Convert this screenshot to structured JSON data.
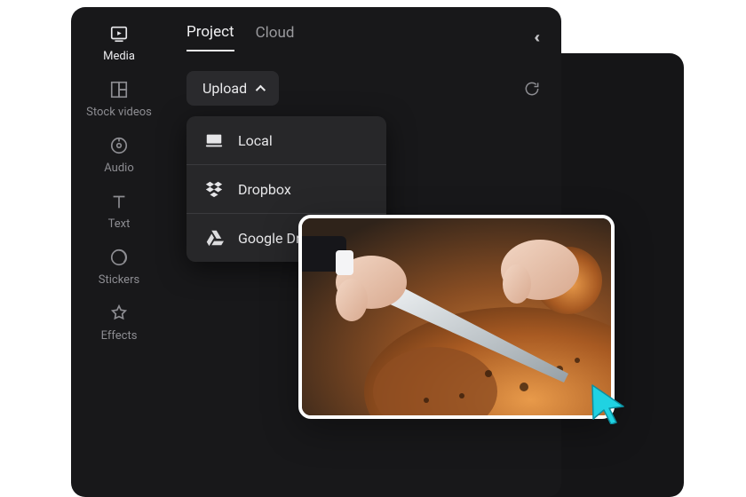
{
  "sidebar": {
    "items": [
      {
        "label": "Media"
      },
      {
        "label": "Stock videos"
      },
      {
        "label": "Audio"
      },
      {
        "label": "Text"
      },
      {
        "label": "Stickers"
      },
      {
        "label": "Effects"
      }
    ]
  },
  "tabs": {
    "project": "Project",
    "cloud": "Cloud"
  },
  "toolbar": {
    "upload_label": "Upload"
  },
  "upload_menu": {
    "items": [
      {
        "label": "Local",
        "icon": "desktop-icon"
      },
      {
        "label": "Dropbox",
        "icon": "dropbox-icon"
      },
      {
        "label": "Google Drive",
        "icon": "google-drive-icon"
      }
    ]
  },
  "thumbnail": {
    "description": "Hands carving a roasted turkey with a knife"
  },
  "colors": {
    "panel_bg": "#18181a",
    "dropdown_bg": "#272729",
    "accent_cursor": "#20c6d6"
  }
}
